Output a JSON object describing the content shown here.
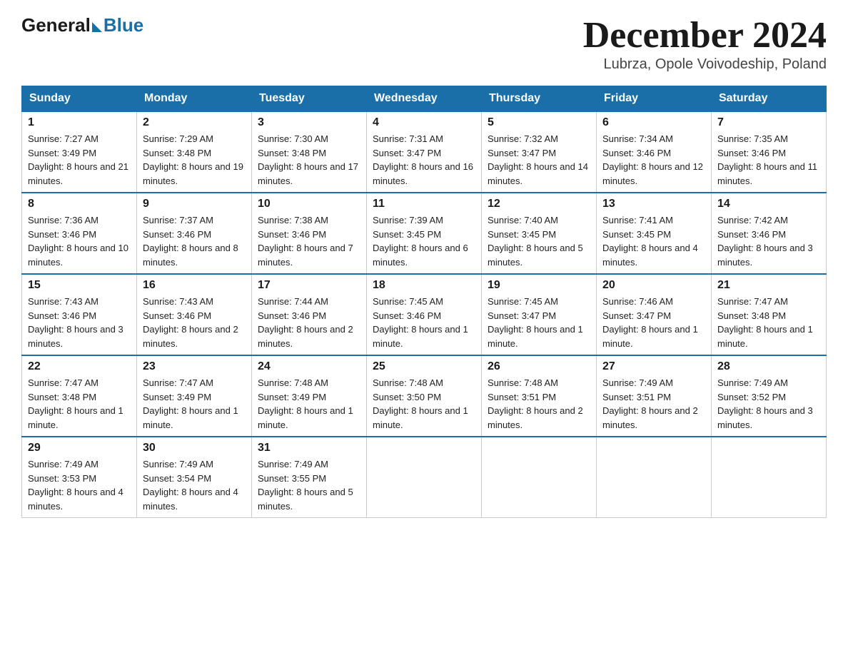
{
  "header": {
    "logo_general": "General",
    "logo_blue": "Blue",
    "month_title": "December 2024",
    "subtitle": "Lubrza, Opole Voivodeship, Poland"
  },
  "days_of_week": [
    "Sunday",
    "Monday",
    "Tuesday",
    "Wednesday",
    "Thursday",
    "Friday",
    "Saturday"
  ],
  "weeks": [
    [
      {
        "day": "1",
        "sunrise": "7:27 AM",
        "sunset": "3:49 PM",
        "daylight": "8 hours and 21 minutes."
      },
      {
        "day": "2",
        "sunrise": "7:29 AM",
        "sunset": "3:48 PM",
        "daylight": "8 hours and 19 minutes."
      },
      {
        "day": "3",
        "sunrise": "7:30 AM",
        "sunset": "3:48 PM",
        "daylight": "8 hours and 17 minutes."
      },
      {
        "day": "4",
        "sunrise": "7:31 AM",
        "sunset": "3:47 PM",
        "daylight": "8 hours and 16 minutes."
      },
      {
        "day": "5",
        "sunrise": "7:32 AM",
        "sunset": "3:47 PM",
        "daylight": "8 hours and 14 minutes."
      },
      {
        "day": "6",
        "sunrise": "7:34 AM",
        "sunset": "3:46 PM",
        "daylight": "8 hours and 12 minutes."
      },
      {
        "day": "7",
        "sunrise": "7:35 AM",
        "sunset": "3:46 PM",
        "daylight": "8 hours and 11 minutes."
      }
    ],
    [
      {
        "day": "8",
        "sunrise": "7:36 AM",
        "sunset": "3:46 PM",
        "daylight": "8 hours and 10 minutes."
      },
      {
        "day": "9",
        "sunrise": "7:37 AM",
        "sunset": "3:46 PM",
        "daylight": "8 hours and 8 minutes."
      },
      {
        "day": "10",
        "sunrise": "7:38 AM",
        "sunset": "3:46 PM",
        "daylight": "8 hours and 7 minutes."
      },
      {
        "day": "11",
        "sunrise": "7:39 AM",
        "sunset": "3:45 PM",
        "daylight": "8 hours and 6 minutes."
      },
      {
        "day": "12",
        "sunrise": "7:40 AM",
        "sunset": "3:45 PM",
        "daylight": "8 hours and 5 minutes."
      },
      {
        "day": "13",
        "sunrise": "7:41 AM",
        "sunset": "3:45 PM",
        "daylight": "8 hours and 4 minutes."
      },
      {
        "day": "14",
        "sunrise": "7:42 AM",
        "sunset": "3:46 PM",
        "daylight": "8 hours and 3 minutes."
      }
    ],
    [
      {
        "day": "15",
        "sunrise": "7:43 AM",
        "sunset": "3:46 PM",
        "daylight": "8 hours and 3 minutes."
      },
      {
        "day": "16",
        "sunrise": "7:43 AM",
        "sunset": "3:46 PM",
        "daylight": "8 hours and 2 minutes."
      },
      {
        "day": "17",
        "sunrise": "7:44 AM",
        "sunset": "3:46 PM",
        "daylight": "8 hours and 2 minutes."
      },
      {
        "day": "18",
        "sunrise": "7:45 AM",
        "sunset": "3:46 PM",
        "daylight": "8 hours and 1 minute."
      },
      {
        "day": "19",
        "sunrise": "7:45 AM",
        "sunset": "3:47 PM",
        "daylight": "8 hours and 1 minute."
      },
      {
        "day": "20",
        "sunrise": "7:46 AM",
        "sunset": "3:47 PM",
        "daylight": "8 hours and 1 minute."
      },
      {
        "day": "21",
        "sunrise": "7:47 AM",
        "sunset": "3:48 PM",
        "daylight": "8 hours and 1 minute."
      }
    ],
    [
      {
        "day": "22",
        "sunrise": "7:47 AM",
        "sunset": "3:48 PM",
        "daylight": "8 hours and 1 minute."
      },
      {
        "day": "23",
        "sunrise": "7:47 AM",
        "sunset": "3:49 PM",
        "daylight": "8 hours and 1 minute."
      },
      {
        "day": "24",
        "sunrise": "7:48 AM",
        "sunset": "3:49 PM",
        "daylight": "8 hours and 1 minute."
      },
      {
        "day": "25",
        "sunrise": "7:48 AM",
        "sunset": "3:50 PM",
        "daylight": "8 hours and 1 minute."
      },
      {
        "day": "26",
        "sunrise": "7:48 AM",
        "sunset": "3:51 PM",
        "daylight": "8 hours and 2 minutes."
      },
      {
        "day": "27",
        "sunrise": "7:49 AM",
        "sunset": "3:51 PM",
        "daylight": "8 hours and 2 minutes."
      },
      {
        "day": "28",
        "sunrise": "7:49 AM",
        "sunset": "3:52 PM",
        "daylight": "8 hours and 3 minutes."
      }
    ],
    [
      {
        "day": "29",
        "sunrise": "7:49 AM",
        "sunset": "3:53 PM",
        "daylight": "8 hours and 4 minutes."
      },
      {
        "day": "30",
        "sunrise": "7:49 AM",
        "sunset": "3:54 PM",
        "daylight": "8 hours and 4 minutes."
      },
      {
        "day": "31",
        "sunrise": "7:49 AM",
        "sunset": "3:55 PM",
        "daylight": "8 hours and 5 minutes."
      },
      null,
      null,
      null,
      null
    ]
  ]
}
